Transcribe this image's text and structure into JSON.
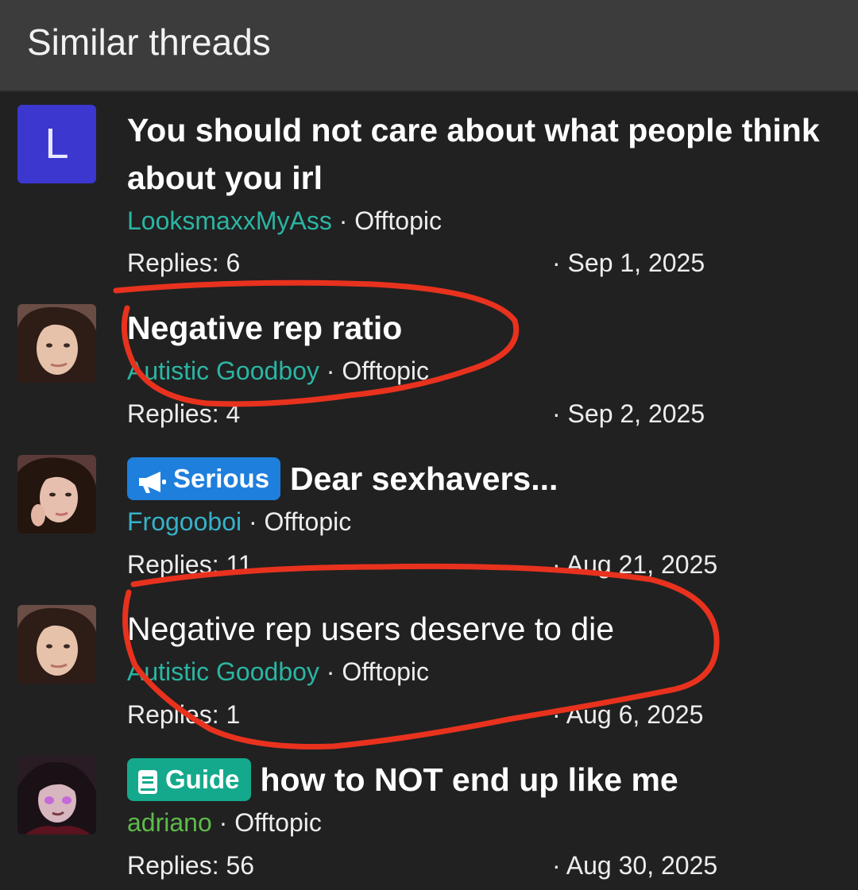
{
  "block": {
    "title": "Similar threads"
  },
  "threads": [
    {
      "avatar_letter": "L",
      "title": "You should not care about what people think about you irl",
      "author": "LooksmaxxMyAss",
      "forum": "Offtopic",
      "replies": "Replies: 6",
      "date": "Sep 1, 2025"
    },
    {
      "title": "Negative rep ratio",
      "author": "Autistic Goodboy",
      "forum": "Offtopic",
      "replies": "Replies: 4",
      "date": "Sep 2, 2025"
    },
    {
      "prefix": "Serious",
      "title": "Dear sexhavers...",
      "author": "Frogooboi",
      "forum": "Offtopic",
      "replies": "Replies: 11",
      "date": "Aug 21, 2025"
    },
    {
      "title": "Negative rep users deserve to die",
      "author": "Autistic Goodboy",
      "forum": "Offtopic",
      "replies": "Replies: 1",
      "date": "Aug 6, 2025"
    },
    {
      "prefix": "Guide",
      "title": "how to NOT end up like me",
      "author": "adriano",
      "forum": "Offtopic",
      "replies": "Replies: 56",
      "date": "Aug 30, 2025"
    }
  ],
  "separator": "·",
  "colors": {
    "annotation": "#e8321e",
    "prefix_serious": "#1e7fdc",
    "prefix_guide": "#14a98d",
    "letter_avatar": "#3b37cf"
  }
}
